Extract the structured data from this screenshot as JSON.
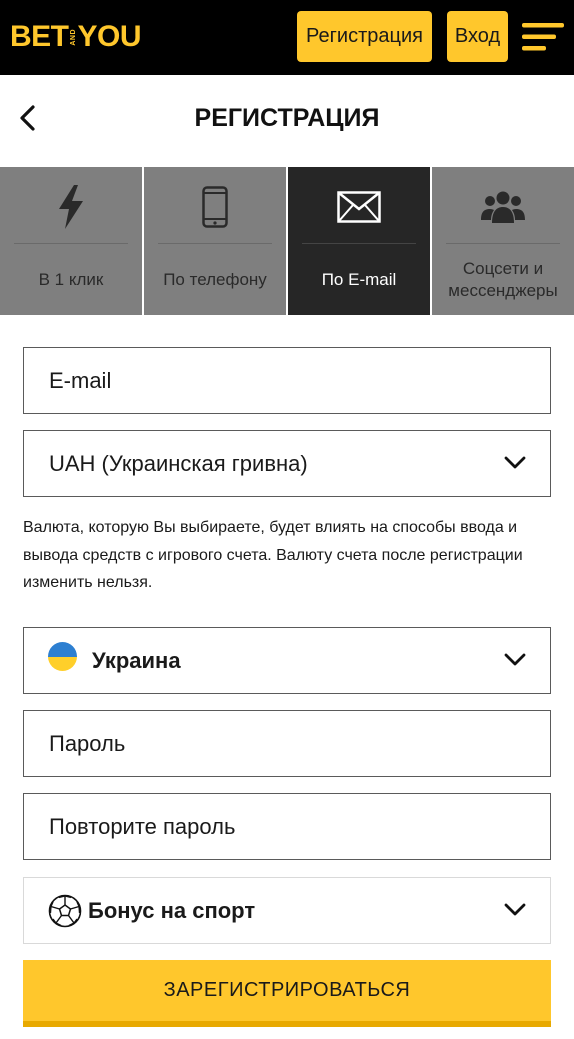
{
  "header": {
    "logo": {
      "bet": "BET",
      "and": "AND",
      "you": "YOU"
    },
    "register_label": "Регистрация",
    "login_label": "Вход",
    "menu_icon": "hamburger-icon"
  },
  "page": {
    "title": "РЕГИСТРАЦИЯ",
    "back_icon": "chevron-left-icon"
  },
  "tabs": [
    {
      "label": "В 1 клик",
      "icon": "lightning-icon",
      "active": false
    },
    {
      "label": "По телефону",
      "icon": "phone-icon",
      "active": false
    },
    {
      "label": "По E-mail",
      "icon": "envelope-icon",
      "active": true
    },
    {
      "label": "Соцсети и мессенджеры",
      "icon": "people-icon",
      "active": false
    }
  ],
  "form": {
    "email_placeholder": "E-mail",
    "currency_value": "UAH (Украинская гривна)",
    "currency_hint": "Валюта, которую Вы выбираете, будет влиять на способы ввода и вывода средств с игрового счета. Валюту счета после регистрации изменить нельзя.",
    "country_value": "Украина",
    "password_placeholder": "Пароль",
    "password_repeat_placeholder": "Повторите пароль",
    "bonus_value": "Бонус на спорт",
    "submit_label": "ЗАРЕГИСТРИРОВАТЬСЯ"
  },
  "colors": {
    "brand_yellow": "#ffc72c",
    "header_bg": "#000000",
    "tab_inactive": "#7f7f7f",
    "tab_active": "#262626",
    "flag_blue": "#2d7fd1",
    "flag_yellow": "#ffcf2a"
  }
}
